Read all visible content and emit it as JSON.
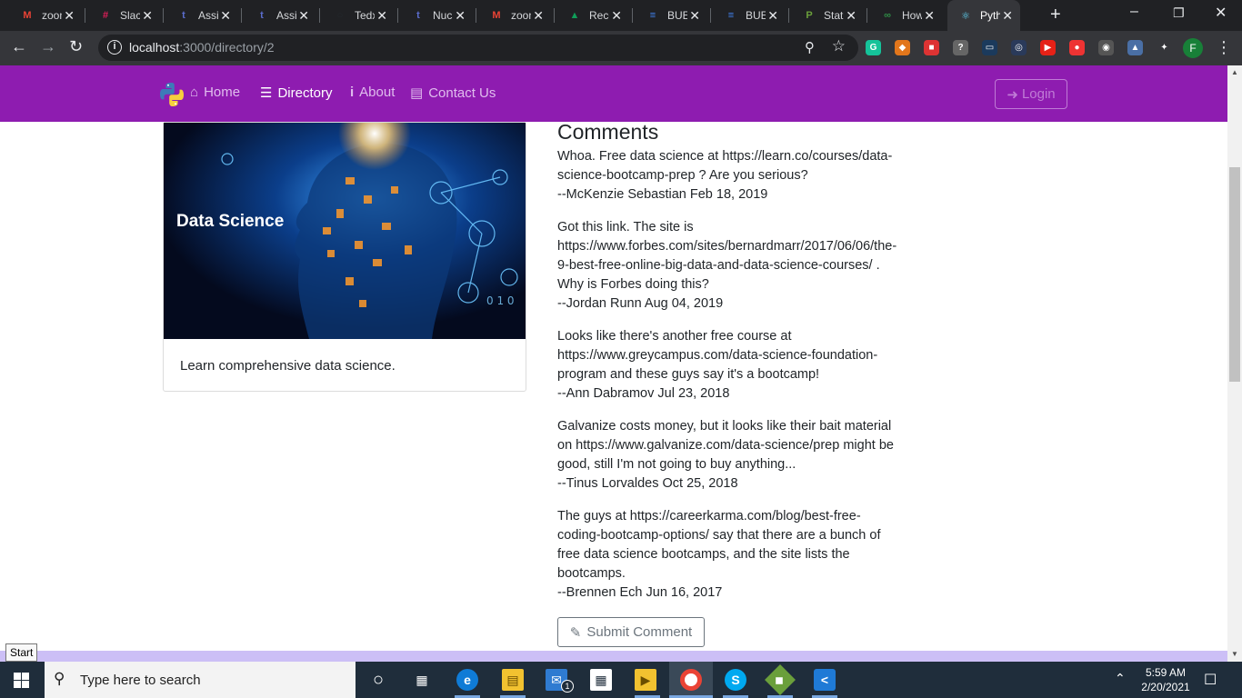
{
  "browser": {
    "tabs": [
      {
        "title": "zoom",
        "favicon": "gmail-icon",
        "color": "#ea4335",
        "glyph": "M"
      },
      {
        "title": "Slack",
        "favicon": "slack-icon",
        "color": "#e01e5a",
        "glyph": "#"
      },
      {
        "title": "Assignment",
        "favicon": "thinkful-icon",
        "color": "#5b6dcd",
        "glyph": "t"
      },
      {
        "title": "Assignment",
        "favicon": "thinkful-icon",
        "color": "#5b6dcd",
        "glyph": "t"
      },
      {
        "title": "Tedx",
        "favicon": "github-icon",
        "color": "#24292e",
        "glyph": "○"
      },
      {
        "title": "Nucamp",
        "favicon": "thinkful-icon",
        "color": "#5b6dcd",
        "glyph": "t"
      },
      {
        "title": "zoom",
        "favicon": "gmail-icon",
        "color": "#ea4335",
        "glyph": "M"
      },
      {
        "title": "Recent",
        "favicon": "drive-icon",
        "color": "#0f9d58",
        "glyph": "▲"
      },
      {
        "title": "BUE",
        "favicon": "docs-icon",
        "color": "#4285f4",
        "glyph": "≡"
      },
      {
        "title": "BUE",
        "favicon": "docs-icon",
        "color": "#4285f4",
        "glyph": "≡"
      },
      {
        "title": "Static",
        "favicon": "pycharm-icon",
        "color": "#6a9f3b",
        "glyph": "P"
      },
      {
        "title": "How",
        "favicon": "geeksforgeeks-icon",
        "color": "#2f8d46",
        "glyph": "∞"
      },
      {
        "title": "Python",
        "favicon": "react-icon",
        "color": "#61dafb",
        "glyph": "⚛",
        "active": true
      }
    ],
    "url_host": "localhost",
    "url_path": ":3000/directory/2",
    "profile_initial": "F",
    "extensions": [
      {
        "name": "grammarly-icon",
        "color": "#15c39a",
        "glyph": "G"
      },
      {
        "name": "metamask-icon",
        "color": "#e2761b",
        "glyph": "◆"
      },
      {
        "name": "extension-red-icon",
        "color": "#d33",
        "glyph": "■"
      },
      {
        "name": "extension-help-icon",
        "color": "#666",
        "glyph": "?"
      },
      {
        "name": "extension-blue-icon",
        "color": "#1b3a5c",
        "glyph": "▭"
      },
      {
        "name": "extension-search-icon",
        "color": "#2a3a5a",
        "glyph": "◎"
      },
      {
        "name": "youtube-icon",
        "color": "#e62117",
        "glyph": "▶"
      },
      {
        "name": "extension-record-icon",
        "color": "#e33",
        "glyph": "●"
      },
      {
        "name": "extension-target-icon",
        "color": "#555",
        "glyph": "◉"
      },
      {
        "name": "extension-drive-icon",
        "color": "#4a6fa5",
        "glyph": "▲"
      },
      {
        "name": "puzzle-icon",
        "color": "#35363a",
        "glyph": "✦"
      }
    ]
  },
  "navbar": {
    "home": "Home",
    "directory": "Directory",
    "about": "About",
    "contact": "Contact Us",
    "login": "Login"
  },
  "card": {
    "image_title": "Data Science",
    "text": "Learn comprehensive data science."
  },
  "comments": {
    "heading": "Comments",
    "items": [
      {
        "lines": [
          "Whoa. Free data science at https://learn.co/courses/data-",
          "science-bootcamp-prep ? Are you serious?"
        ],
        "byline": "--McKenzie Sebastian Feb 18, 2019"
      },
      {
        "lines": [
          "Got this link. The site is",
          "https://www.forbes.com/sites/bernardmarr/2017/06/06/the-",
          "9-best-free-online-big-data-and-data-science-courses/ .",
          "Why is Forbes doing this?"
        ],
        "byline": "--Jordan Runn Aug 04, 2019"
      },
      {
        "lines": [
          "Looks like there's another free course at",
          "https://www.greycampus.com/data-science-foundation-",
          "program and these guys say it's a bootcamp!"
        ],
        "byline": "--Ann Dabramov Jul 23, 2018"
      },
      {
        "lines": [
          "Galvanize costs money, but it looks like their bait material",
          "on https://www.galvanize.com/data-science/prep might be",
          "good, still I'm not going to buy anything..."
        ],
        "byline": "--Tinus Lorvaldes Oct 25, 2018"
      },
      {
        "lines": [
          "The guys at https://careerkarma.com/blog/best-free-",
          "coding-bootcamp-options/ say that there are a bunch of",
          "free data science bootcamps, and the site lists the",
          "bootcamps."
        ],
        "byline": "--Brennen Ech Jun 16, 2017"
      }
    ],
    "submit": "Submit Comment"
  },
  "tooltip": "Start",
  "taskbar": {
    "search_placeholder": "Type here to search",
    "time": "5:59 AM",
    "date": "2/20/2021",
    "mail_badge": "1"
  },
  "colors": {
    "navbar": "#8e1cb0",
    "footer": "#ccbff6"
  }
}
